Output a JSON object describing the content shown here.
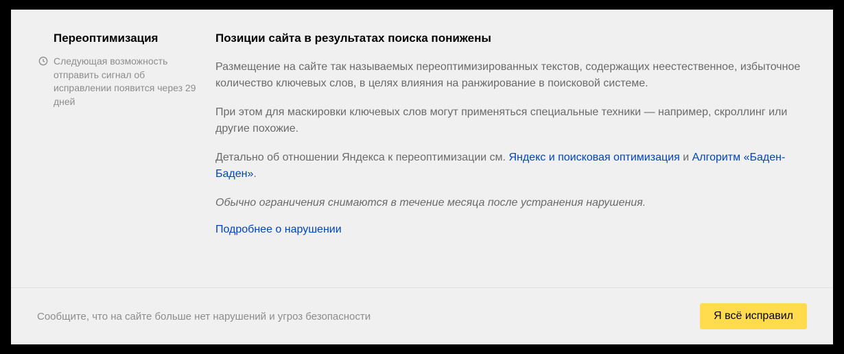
{
  "sidebar": {
    "title": "Переоптимизация",
    "note": "Следующая возможность отправить сигнал об исправлении появится через 29 дней"
  },
  "main": {
    "title": "Позиции сайта в результатах поиска понижены",
    "paragraph1": "Размещение на сайте так называемых переоптимизированных текстов, содержащих неестественное, избыточное количество ключевых слов, в целях влияния на ранжирование в поисковой системе.",
    "paragraph2": "При этом для маскировки ключевых слов могут применяться специальные техники — например, скроллинг или другие похожие.",
    "paragraph3_before": "Детально об отношении Яндекса к переоптимизации см. ",
    "link1": "Яндекс и поисковая оптимизация",
    "paragraph3_middle": " и ",
    "link2": "Алгоритм «Баден-Баден»",
    "paragraph3_after": ".",
    "paragraph4": "Обычно ограничения снимаются в течение месяца после устранения нарушения.",
    "more_link": "Подробнее о нарушении"
  },
  "footer": {
    "text": "Сообщите, что на сайте больше нет нарушений и угроз безопасности",
    "button": "Я всё исправил"
  }
}
